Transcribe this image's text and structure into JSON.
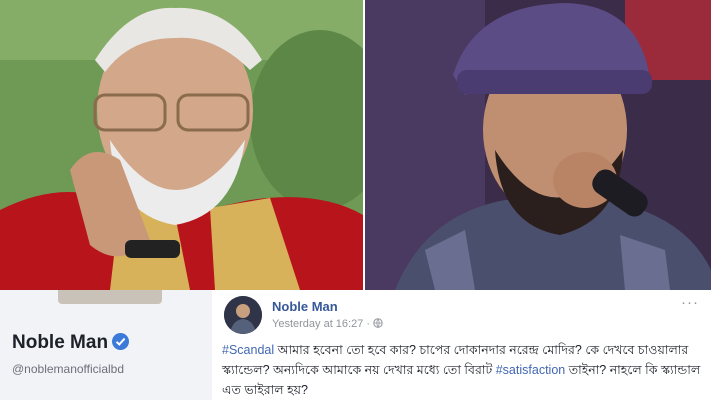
{
  "profile": {
    "name": "Noble Man",
    "handle": "@noblemanofficialbd"
  },
  "post": {
    "author": "Noble Man",
    "timestamp": "Yesterday at 16:27 · ",
    "menu": "···",
    "hashtag": "#Scandal",
    "text_1": " আমার হবেনা তো হবে কার? চাপের দোকানদার নরেন্দ্র মোদির? কে দেখবে চাওয়ালার স্ক্যান্ডেল? অন্যদিকে আমাকে নয় দেখার মধ্যে তো বিরাট ",
    "hashtag_2": "#satisfaction",
    "text_2": " তাইনা? নাহলে কি স্ক্যান্ডাল এত ভাইরাল হয়?"
  },
  "colors": {
    "link": "#365899",
    "hashtag": "#4267b2",
    "verified": "#3b7ad9"
  }
}
